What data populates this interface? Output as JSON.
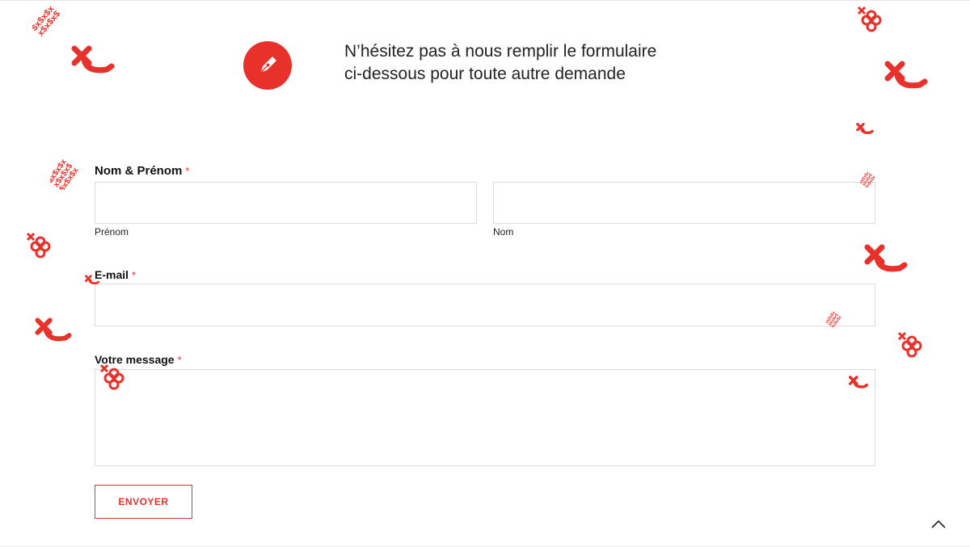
{
  "header": {
    "icon": "pen-nib-icon",
    "intro_line1": "N’hésitez pas à nous remplir le formulaire",
    "intro_line2": "ci-dessous pour toute autre demande"
  },
  "form": {
    "name": {
      "label": "Nom & Prénom",
      "required_mark": "*",
      "first_sublabel": "Prénom",
      "last_sublabel": "Nom",
      "first_value": "",
      "last_value": ""
    },
    "email": {
      "label": "E-mail",
      "required_mark": "*",
      "value": ""
    },
    "message": {
      "label": "Votre message",
      "required_mark": "*",
      "value": ""
    },
    "submit_label": "ENVOYER"
  },
  "scroll_top": {
    "icon": "chevron-up-icon"
  },
  "colors": {
    "accent": "#e8312a",
    "field_border": "#dcdcdc",
    "text": "#1a1a1a"
  },
  "decorations": {
    "icons": [
      "cross-hook-icon",
      "knot-icon",
      "dollar-chain-icon"
    ]
  }
}
